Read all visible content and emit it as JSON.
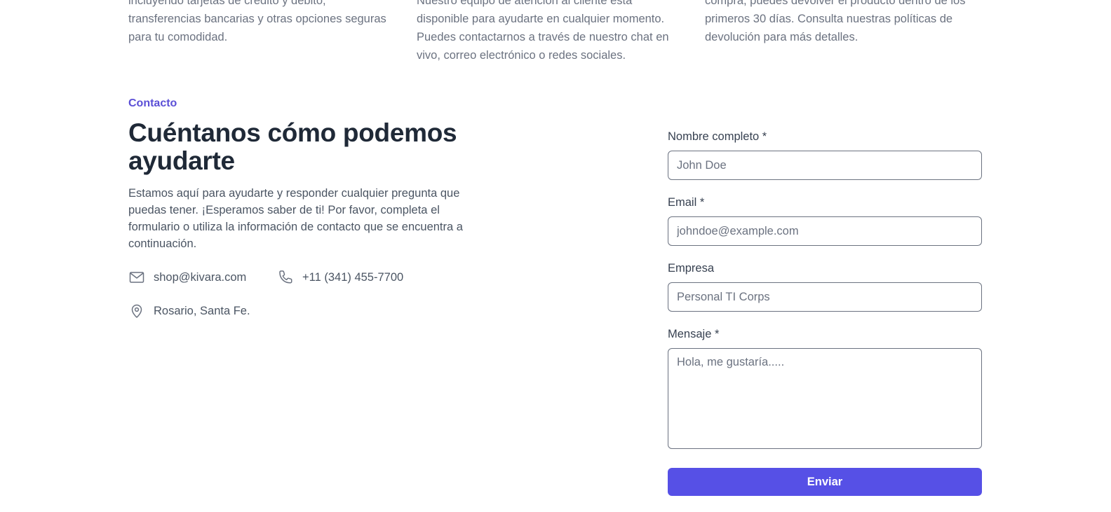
{
  "faq": {
    "columns": [
      {
        "lines": [
          "incluyendo tarjetas de crédito y débito,",
          "transferencias bancarias y otras opciones seguras",
          "para tu comodidad."
        ]
      },
      {
        "lines": [
          "Nuestro equipo de atención al cliente está",
          "disponible para ayudarte en cualquier momento.",
          "Puedes contactarnos a través de nuestro chat en",
          "vivo, correo electrónico o redes sociales."
        ]
      },
      {
        "lines": [
          "compra, puedes devolver el producto dentro de los",
          "primeros 30 días. Consulta nuestras políticas de",
          "devolución para más detalles."
        ]
      }
    ]
  },
  "contact": {
    "eyebrow": "Contacto",
    "heading": "Cuéntanos cómo podemos ayudarte",
    "intro": "Estamos aquí para ayudarte y responder cualquier pregunta que puedas tener. ¡Esperamos saber de ti! Por favor, completa el formulario o utiliza la información de contacto que se encuentra a continuación.",
    "email": "shop@kivara.com",
    "phone": "+11 (341) 455-7700",
    "location": "Rosario, Santa Fe.",
    "icons": {
      "email": "envelope-icon",
      "phone": "phone-icon",
      "location": "map-pin-icon"
    }
  },
  "form": {
    "name_label": "Nombre completo *",
    "name_placeholder": "John Doe",
    "email_label": "Email *",
    "email_placeholder": "johndoe@example.com",
    "company_label": "Empresa",
    "company_placeholder": "Personal TI Corps",
    "message_label": "Mensaje *",
    "message_placeholder": "Hola, me gustaría.....",
    "submit_label": "Enviar"
  },
  "colors": {
    "accent": "#5650e6",
    "eyebrow": "#5b4fd6",
    "heading": "#1f2937",
    "body_text": "#4b5563"
  }
}
